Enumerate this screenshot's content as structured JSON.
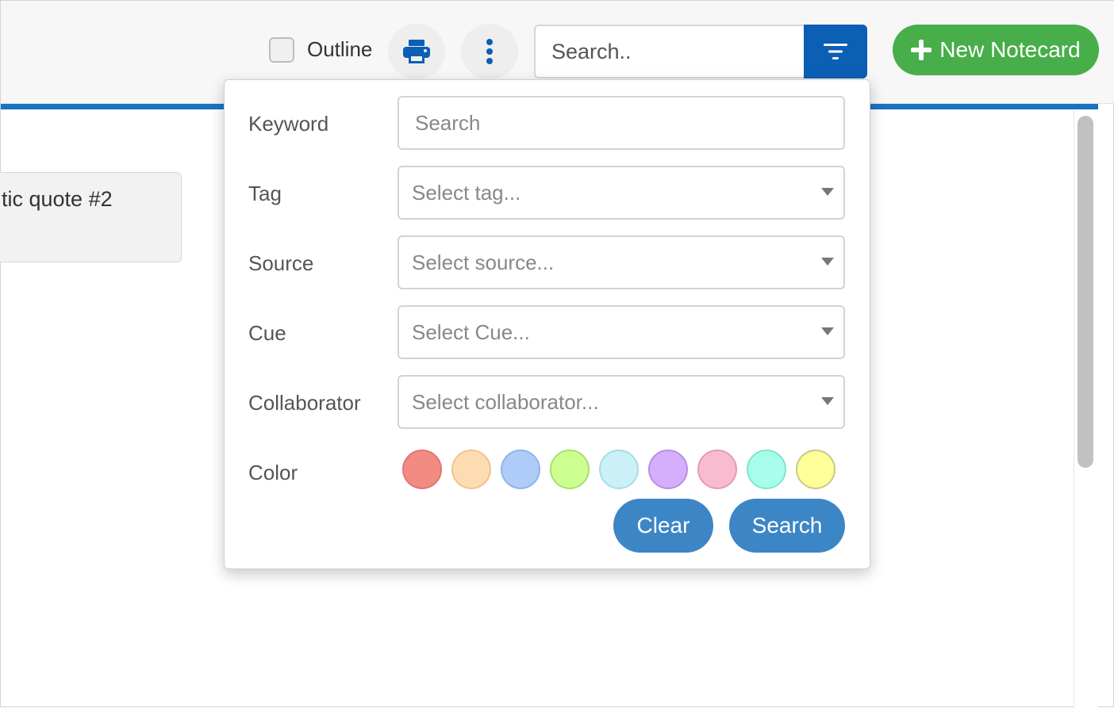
{
  "toolbar": {
    "outline_label": "Outline",
    "search_placeholder": "Search..",
    "new_notecard_label": "New Notecard"
  },
  "card": {
    "title": "tic quote #2"
  },
  "filter_panel": {
    "keyword": {
      "label": "Keyword",
      "placeholder": "Search"
    },
    "tag": {
      "label": "Tag",
      "placeholder": "Select tag..."
    },
    "source": {
      "label": "Source",
      "placeholder": "Select source..."
    },
    "cue": {
      "label": "Cue",
      "placeholder": "Select Cue..."
    },
    "collaborator": {
      "label": "Collaborator",
      "placeholder": "Select collaborator..."
    },
    "color": {
      "label": "Color",
      "swatches": [
        {
          "fill": "#f28b82",
          "border": "#e57373"
        },
        {
          "fill": "#fddcb2",
          "border": "#f0c48a"
        },
        {
          "fill": "#aecbfa",
          "border": "#8fb3ee"
        },
        {
          "fill": "#ccff90",
          "border": "#a8e06a"
        },
        {
          "fill": "#cbf0f8",
          "border": "#a9dbe8"
        },
        {
          "fill": "#d7aefb",
          "border": "#b98de8"
        },
        {
          "fill": "#f8bbd0",
          "border": "#e69ab6"
        },
        {
          "fill": "#a7ffeb",
          "border": "#7fe5cc"
        },
        {
          "fill": "#ffff99",
          "border": "#c9c98a"
        }
      ]
    },
    "clear_label": "Clear",
    "search_label": "Search"
  },
  "colors": {
    "accent_blue": "#1a73c2",
    "filter_button": "#0b5fb5",
    "new_button_green": "#47ae4a",
    "pill_button_blue": "#3d86c6"
  }
}
